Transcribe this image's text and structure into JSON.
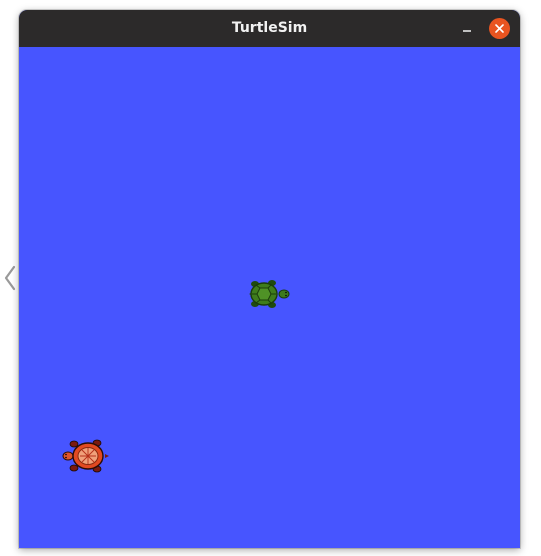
{
  "window": {
    "title": "TurtleSim"
  },
  "colors": {
    "titlebar": "#2c2a2a",
    "canvas_background": "#4755ff",
    "close_button": "#e95420",
    "title_text": "#f2f2f2"
  },
  "icons": {
    "minimize": "minimize-icon",
    "close": "close-icon",
    "side_arrow": "chevron-left-icon",
    "turtle_green": "turtle-icon",
    "turtle_red": "turtle-icon"
  }
}
